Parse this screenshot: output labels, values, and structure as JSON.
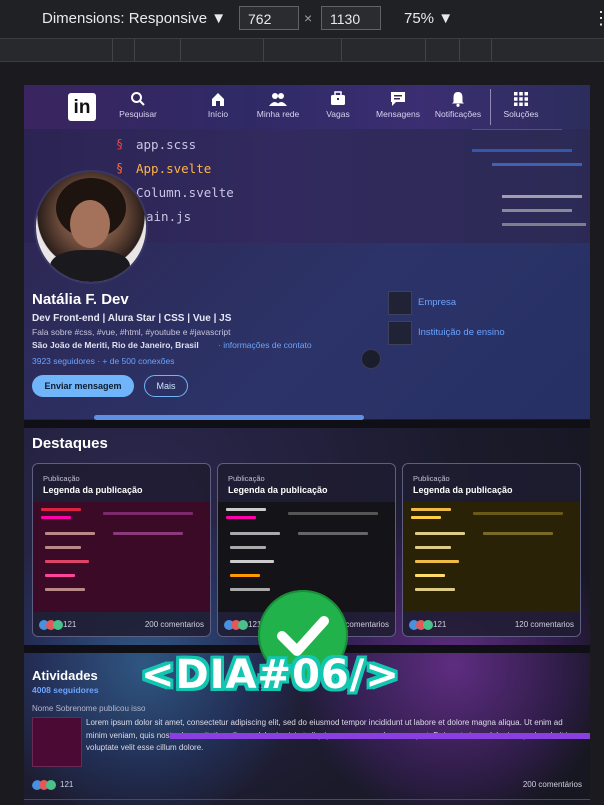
{
  "devtools": {
    "dimensions_label": "Dimensions: Responsive ▼",
    "width": "762",
    "times": "×",
    "height": "1130",
    "zoom": "75% ▼",
    "menu": "⋮"
  },
  "nav": {
    "logo": "in",
    "items": [
      {
        "label": "Pesquisar",
        "icon": "search-icon"
      },
      {
        "label": "Início",
        "icon": "home-icon"
      },
      {
        "label": "Minha rede",
        "icon": "network-icon"
      },
      {
        "label": "Vagas",
        "icon": "briefcase-icon"
      },
      {
        "label": "Mensagens",
        "icon": "message-icon"
      },
      {
        "label": "Notificações",
        "icon": "bell-icon"
      },
      {
        "label": "Soluções",
        "icon": "grid-icon"
      }
    ]
  },
  "cover": {
    "files": [
      "app.scss",
      "App.svelte",
      "Column.svelte",
      "ain.js"
    ]
  },
  "profile": {
    "name": "Natália F. Dev",
    "headline": "Dev Front-end | Alura Star | CSS | Vue | JS",
    "about": "Fala sobre #css, #vue, #html, #youtube e #javascript",
    "location": "São João de Meriti, Rio de Janeiro, Brasil",
    "contact_link": "· informações de contato",
    "followers": "3923 seguidores · + de 500 conexões",
    "message_button": "Enviar mensagem",
    "more_button": "Mais",
    "company": "Empresa",
    "school": "Instituição de ensino"
  },
  "highlights": {
    "title": "Destaques",
    "cards": [
      {
        "type": "Publicação",
        "caption": "Legenda da publicação",
        "reactions": "121",
        "comments": "200 comentarios"
      },
      {
        "type": "Publicação",
        "caption": "Legenda da publicação",
        "reactions": "121",
        "comments": "200 comentarios"
      },
      {
        "type": "Publicação",
        "caption": "Legenda da publicação",
        "reactions": "121",
        "comments": "120 comentarios"
      }
    ]
  },
  "activities": {
    "title": "Atividades",
    "followers": "4008 seguidores",
    "author_line": "Nome Sobrenome publicou isso",
    "text": "Lorem ipsum dolor sit amet, consectetur adipiscing elit, sed do eiusmod tempor incididunt ut labore et dolore magna aliqua. Ut enim ad minim veniam, quis nostrud exercitation ullamco laboris nisi ut aliquip ex ea commodo consequat. Duis aute irure dolor in reprehenderit in voluptate velit esse cillum dolore.",
    "reactions": "121",
    "comments": "200 comentários"
  },
  "overlay": {
    "badge_text": "<DIA#06/>",
    "icon": "checkmark-icon"
  },
  "colors": {
    "accent_blue": "#70b5f9",
    "link_blue": "#6ba4ff",
    "check_green": "#22b24c",
    "badge_teal": "#12c6b0",
    "nav_purple": "#3a2560"
  }
}
